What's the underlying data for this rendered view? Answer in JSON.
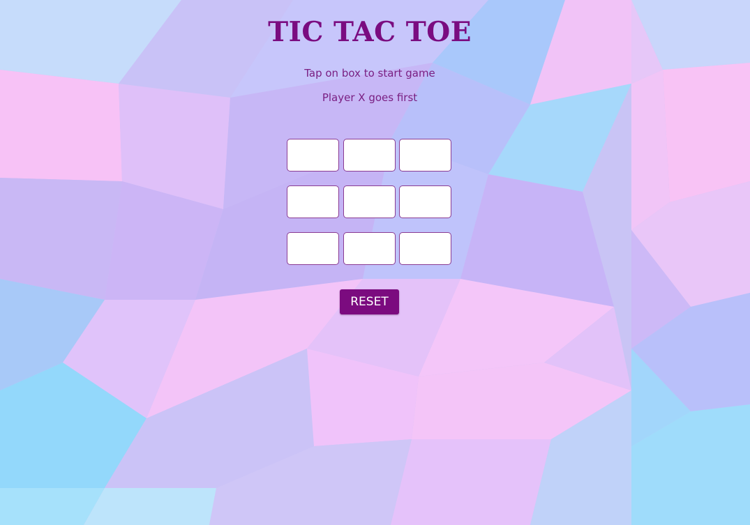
{
  "game": {
    "title": "TIC TAC TOE",
    "instruction": "Tap on box to start game",
    "turn_message": "Player X goes first",
    "board": [
      "",
      "",
      "",
      "",
      "",
      "",
      "",
      "",
      ""
    ],
    "reset_label": "RESET"
  },
  "colors": {
    "accent": "#7b0b7f",
    "cell_background": "#ffffff",
    "cell_border": "#8a3b92",
    "background_palette": [
      "#f9c6f5",
      "#a6dcfc",
      "#cbbcf7",
      "#e9c7fb",
      "#b5c9fb"
    ]
  }
}
